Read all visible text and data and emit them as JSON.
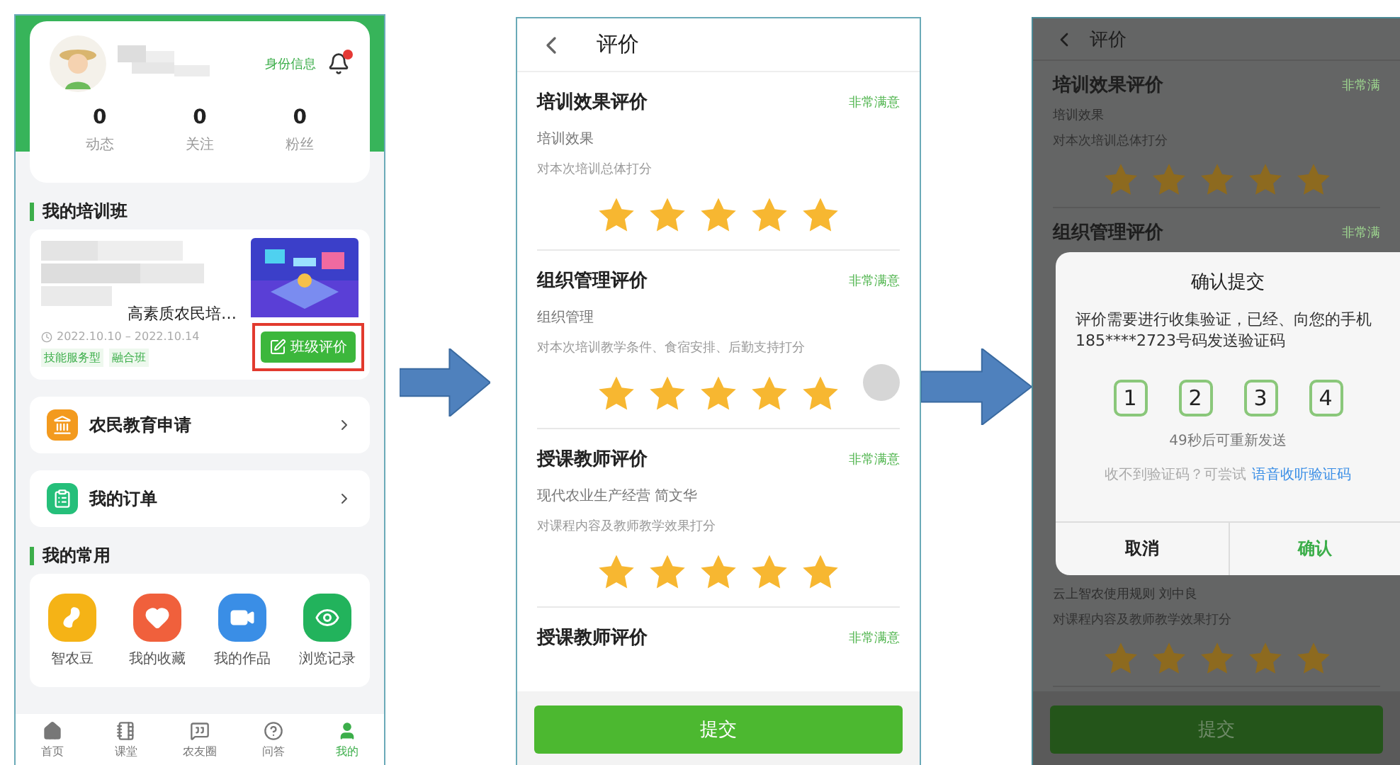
{
  "profile_screen": {
    "identity_link": "身份信息",
    "stats": [
      {
        "value": "0",
        "label": "动态"
      },
      {
        "value": "0",
        "label": "关注"
      },
      {
        "value": "0",
        "label": "粉丝"
      }
    ],
    "course_section": {
      "title": "我的培训班",
      "course": {
        "title": "高素质农民培…",
        "dates": "2022.10.10 – 2022.10.14",
        "tags": [
          "技能服务型",
          "融合班"
        ],
        "action": "班级评价",
        "highlighted": true
      }
    },
    "menu": [
      {
        "label": "农民教育申请",
        "kind": "apply"
      },
      {
        "label": "我的订单",
        "kind": "orders"
      }
    ],
    "shortcuts_section": {
      "title": "我的常用",
      "items": [
        {
          "label": "智农豆",
          "kind": "bean",
          "color": "#f5b316"
        },
        {
          "label": "我的收藏",
          "kind": "favorite",
          "color": "#f0603c"
        },
        {
          "label": "我的作品",
          "kind": "video",
          "color": "#3a8ee6"
        },
        {
          "label": "浏览记录",
          "kind": "history",
          "color": "#22b35c"
        }
      ]
    },
    "tab_bar": [
      {
        "label": "首页",
        "kind": "home",
        "selected": false
      },
      {
        "label": "课堂",
        "kind": "class",
        "selected": false
      },
      {
        "label": "农友圈",
        "kind": "circle",
        "selected": false
      },
      {
        "label": "问答",
        "kind": "qa",
        "selected": false
      },
      {
        "label": "我的",
        "kind": "me",
        "selected": true
      }
    ]
  },
  "evaluation_screen": {
    "title": "评价",
    "sections": [
      {
        "title": "培训效果评价",
        "rating_label": "非常满意",
        "subtitle": "培训效果",
        "description": "对本次培训总体打分",
        "stars": 5
      },
      {
        "title": "组织管理评价",
        "rating_label": "非常满意",
        "subtitle": "组织管理",
        "description": "对本次培训教学条件、食宿安排、后勤支持打分",
        "stars": 5
      },
      {
        "title": "授课教师评价",
        "rating_label": "非常满意",
        "subtitle": "现代农业生产经营 简文华",
        "description": "对课程内容及教师教学效果打分",
        "stars": 5
      },
      {
        "title": "授课教师评价",
        "rating_label": "非常满意"
      }
    ],
    "submit": "提交"
  },
  "confirm_screen": {
    "title": "评价",
    "top_sections": [
      {
        "title": "培训效果评价",
        "rating_label": "非常满",
        "subtitle": "培训效果",
        "description": "对本次培训总体打分",
        "stars": 5
      },
      {
        "title": "组织管理评价",
        "rating_label": "非常满"
      }
    ],
    "bottom_section": {
      "subtitle": "云上智农使用规则 刘中良",
      "description": "对课程内容及教师教学效果打分",
      "stars": 5
    },
    "submit": "提交",
    "dialog": {
      "title": "确认提交",
      "message": "评价需要进行收集验证，已经、向您的手机185****2723号码发送验证码",
      "code": [
        "1",
        "2",
        "3",
        "4"
      ],
      "countdown": "49秒后可重新发送",
      "hint": "收不到验证码？可尝试",
      "voice_link": "语音收听验证码",
      "cancel": "取消",
      "confirm": "确认"
    }
  }
}
